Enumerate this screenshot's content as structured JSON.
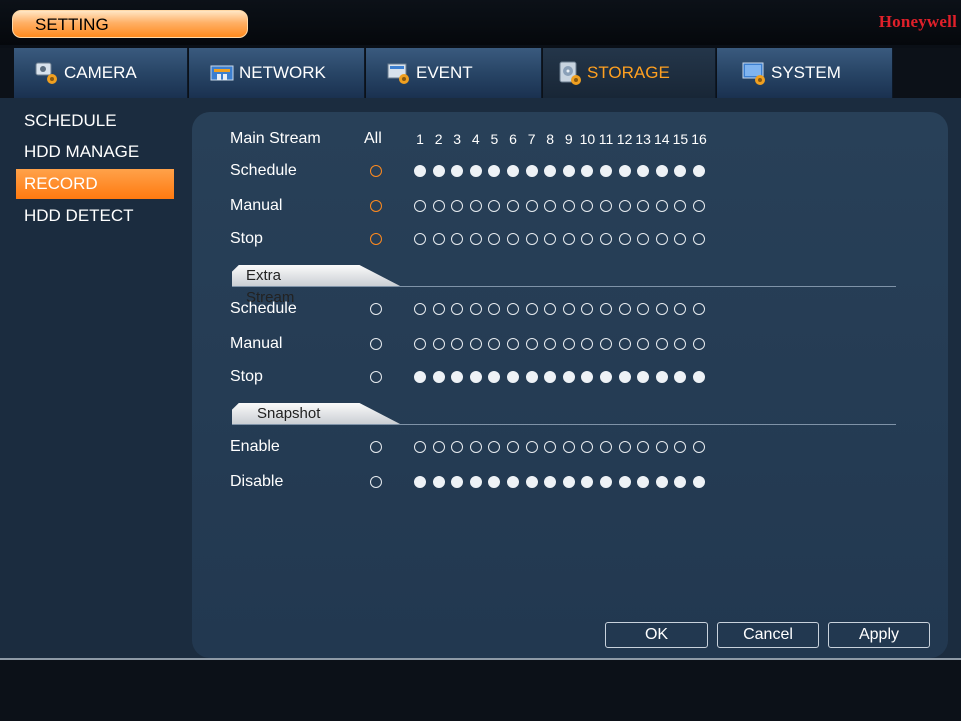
{
  "header": {
    "title": "SETTING",
    "brand": "Honeywell"
  },
  "tabs": [
    {
      "label": "CAMERA",
      "icon": "camera-settings-icon",
      "active": false
    },
    {
      "label": "NETWORK",
      "icon": "network-icon",
      "active": false
    },
    {
      "label": "EVENT",
      "icon": "event-icon",
      "active": false
    },
    {
      "label": "STORAGE",
      "icon": "storage-icon",
      "active": true
    },
    {
      "label": "SYSTEM",
      "icon": "system-icon",
      "active": false
    }
  ],
  "sidebar": {
    "items": [
      {
        "label": "SCHEDULE",
        "active": false
      },
      {
        "label": "HDD MANAGE",
        "active": false
      },
      {
        "label": "RECORD",
        "active": true
      },
      {
        "label": "HDD DETECT",
        "active": false
      }
    ]
  },
  "record": {
    "main_stream_label": "Main Stream",
    "all_label": "All",
    "channels": [
      "1",
      "2",
      "3",
      "4",
      "5",
      "6",
      "7",
      "8",
      "9",
      "10",
      "11",
      "12",
      "13",
      "14",
      "15",
      "16"
    ],
    "main_rows": [
      {
        "label": "Schedule",
        "all_state": "orange",
        "selected": true
      },
      {
        "label": "Manual",
        "all_state": "orange",
        "selected": false
      },
      {
        "label": "Stop",
        "all_state": "orange",
        "selected": false
      }
    ],
    "extra_stream_label": "Extra Stream",
    "extra_rows": [
      {
        "label": "Schedule",
        "all_state": "empty",
        "selected": false
      },
      {
        "label": "Manual",
        "all_state": "empty",
        "selected": false
      },
      {
        "label": "Stop",
        "all_state": "empty",
        "selected": true
      }
    ],
    "snapshot_label": "Snapshot",
    "snapshot_rows": [
      {
        "label": "Enable",
        "all_state": "empty",
        "selected": false
      },
      {
        "label": "Disable",
        "all_state": "empty",
        "selected": true
      }
    ]
  },
  "buttons": {
    "ok": "OK",
    "cancel": "Cancel",
    "apply": "Apply"
  },
  "colors": {
    "accent": "#ff8a1e",
    "brand": "#e0202a",
    "panel": "#223850"
  }
}
